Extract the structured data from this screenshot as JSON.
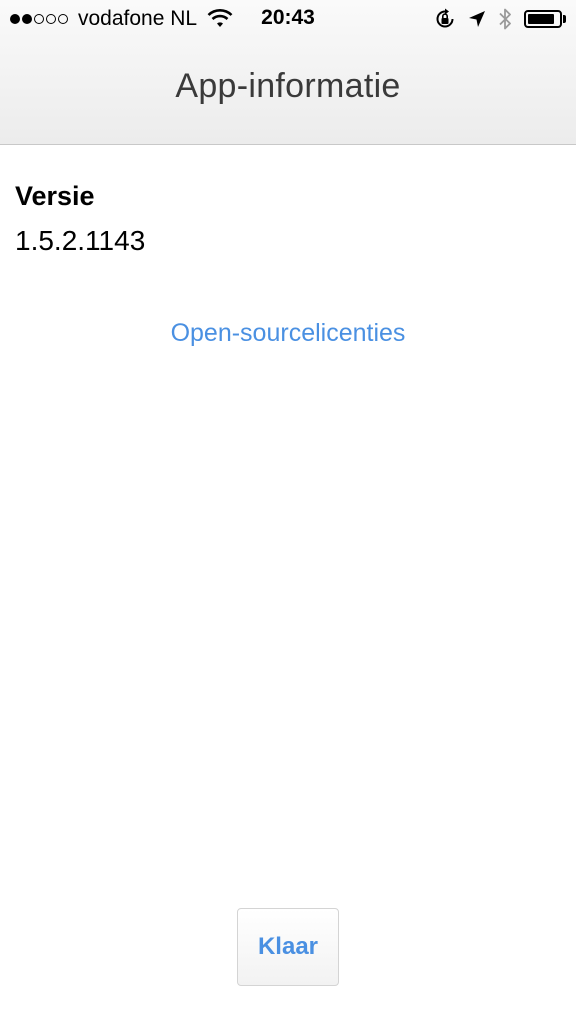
{
  "status_bar": {
    "carrier": "vodafone NL",
    "time": "20:43",
    "signal_full": 2,
    "signal_empty": 3,
    "battery_level": 0.85,
    "icons": [
      "wifi-icon",
      "rotation-lock-icon",
      "location-arrow-icon",
      "bluetooth-icon",
      "battery-icon"
    ]
  },
  "nav": {
    "title": "App-informatie"
  },
  "info": {
    "version_label": "Versie",
    "version_value": "1.5.2.1143",
    "licenses_link": "Open-sourcelicenties"
  },
  "footer": {
    "done_label": "Klaar"
  },
  "colors": {
    "link": "#4a90e2",
    "title": "#3a3a3a"
  }
}
